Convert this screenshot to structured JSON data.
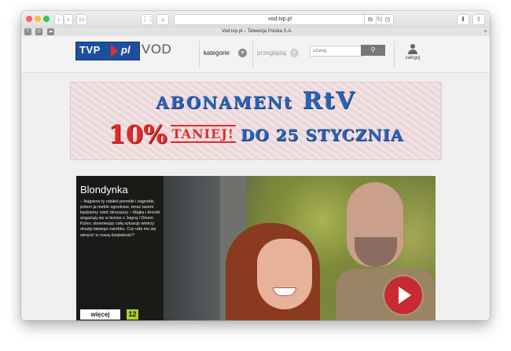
{
  "browser": {
    "url": "vod.tvp.pl",
    "tab_title": "Vod.tvp.pl – Telewizja Polska S.A.",
    "buttons": {
      "back_icon": "chevron-left-icon",
      "forward_icon": "chevron-right-icon",
      "sidebar_icon": "sidebar-icon",
      "grid_icon": "grid-icon",
      "home_icon": "home-icon",
      "reload_icon": "reload-icon",
      "download_icon": "download-icon",
      "share_icon": "share-icon"
    },
    "favorites_icons": [
      "facebook-icon",
      "instagram-icon",
      "cloud-icon"
    ]
  },
  "site": {
    "logo_text": "TVP",
    "logo_suffix": "pl",
    "vod_label": "VOD",
    "nav": {
      "categories_label": "kategorie",
      "browse_label": "przeglądaj"
    },
    "search": {
      "placeholder": "szukaj"
    },
    "login_label": "zaloguj",
    "brand_color": "#1d4f9c"
  },
  "banner": {
    "line1_a": "ABONAMENt",
    "line1_b": "RtV",
    "line2_pct": "10%",
    "line2_taniej": "TANIEJ!",
    "line2_date": "DO 25 STYCZNIA",
    "colors": {
      "blue": "#2b62b5",
      "red": "#e02b2b"
    }
  },
  "hero": {
    "title": "Blondynka",
    "description": "– Najpierw ty robiłeś pomniki i nagrobki, potem ja meble ogrodowe, teraz razem będziemy robić dinozaury – Majka i Arnold angażują się w biznes z Jagną i Dinem. Kizior, obserwując całą sytuację wietrzy okazję łatwego zarobku. Czy uda mu się wkręcić w nową działalność?",
    "more_label": "więcej",
    "age_rating": "12",
    "play_color": "#c72a33"
  }
}
